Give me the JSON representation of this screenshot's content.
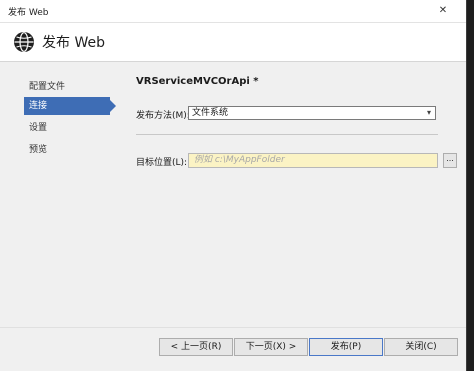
{
  "window": {
    "title": "发布 Web",
    "close_symbol": "✕"
  },
  "header": {
    "icon": "globe-icon",
    "title": "发布 Web"
  },
  "nav": {
    "items": [
      {
        "label": "配置文件",
        "active": false
      },
      {
        "label": "连接",
        "active": true
      },
      {
        "label": "设置",
        "active": false
      },
      {
        "label": "预览",
        "active": false
      }
    ]
  },
  "main": {
    "profile_name": "VRServiceMVCOrApi *",
    "publish_method_label": "发布方法(M):",
    "publish_method_value": "文件系统",
    "target_location_label": "目标位置(L):",
    "target_location_placeholder": "例如 c:\\MyAppFolder",
    "browse_label": "..."
  },
  "footer": {
    "prev_label": "< 上一页(R)",
    "next_label": "下一页(X) >",
    "publish_label": "发布(P)",
    "close_label": "关闭(C)"
  },
  "colors": {
    "accent": "#3e6db5",
    "input_highlight": "#fbf3c4"
  }
}
